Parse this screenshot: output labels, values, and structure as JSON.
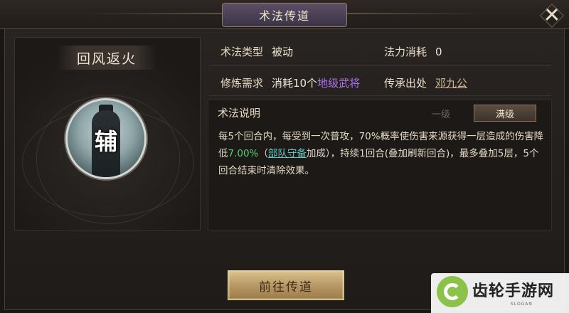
{
  "window": {
    "title": "术法传道",
    "close_symbol": "✕"
  },
  "skill": {
    "name": "回风返火",
    "role_badge": "辅"
  },
  "info": {
    "type_label": "术法类型",
    "type_value": "被动",
    "cost_label": "法力消耗",
    "cost_value": "0",
    "train_label": "修炼需求",
    "train_prefix": "消耗10个",
    "train_highlight": "地级武将",
    "origin_label": "传承出处",
    "origin_value": "邓九公"
  },
  "description": {
    "title": "术法说明",
    "tabs": [
      "一级",
      "满级"
    ],
    "active_tab": "满级",
    "part1": "每5个回合内，每受到一次普攻，70%概率使伤害来源获得一层造成的伤害降低",
    "value": "7.00%",
    "part2": "（",
    "link": "部队守备",
    "part3": "加成），持续1回合(叠加刷新回合)，最多叠加5层，5个回合结束时清除效果。"
  },
  "actions": {
    "go_label": "前往传道"
  },
  "watermark": {
    "text": "齿轮手游网",
    "slogan": "SLOGAN"
  },
  "colors": {
    "highlight_purple": "#a873e8",
    "value_green": "#57d26e",
    "link_teal": "#5fc8c5",
    "button_gold": "#c9ad78"
  }
}
